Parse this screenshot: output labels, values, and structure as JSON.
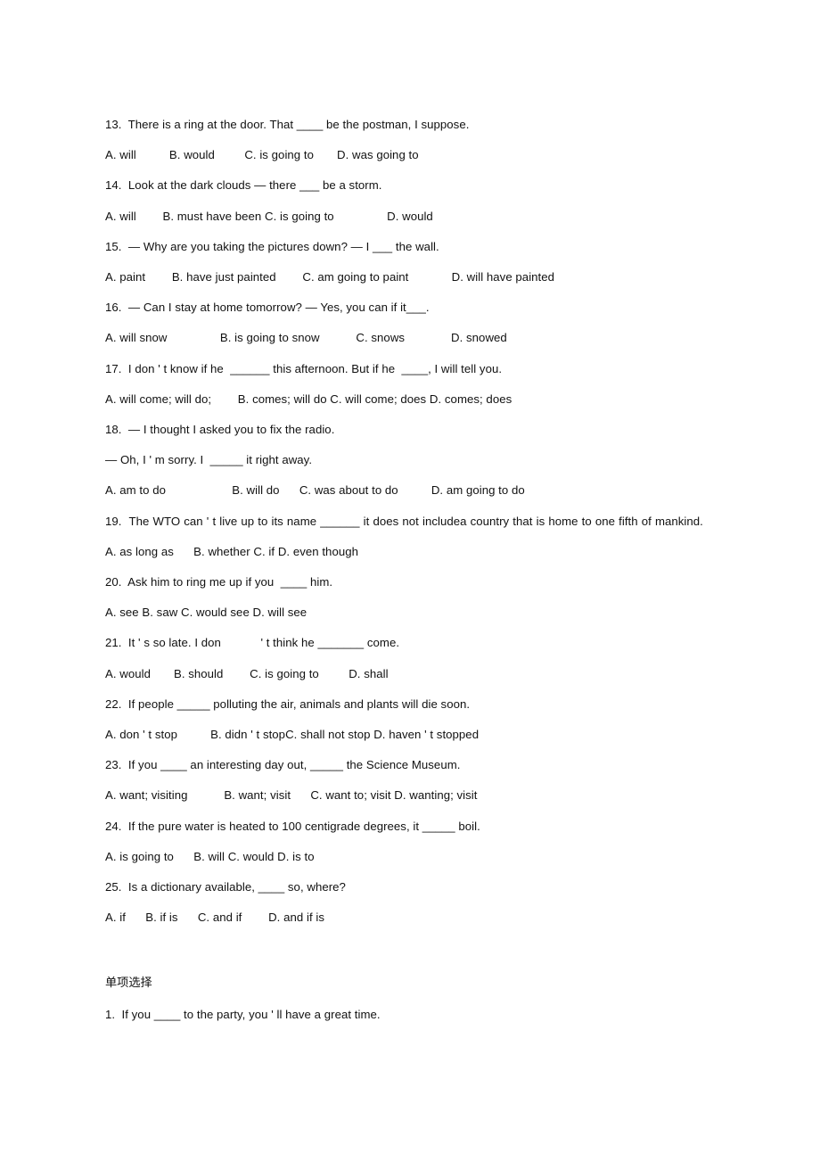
{
  "document": {
    "type": "english-grammar-worksheet",
    "page_background": "#ffffff",
    "text_color": "#111111",
    "blocks": [
      {
        "id": "q13_stem",
        "role": "question-stem",
        "text": "13.  There is a ring at the door. That ____ be the postman, I suppose."
      },
      {
        "id": "q13_opts",
        "role": "answer-options",
        "text": "A. will          B. would         C. is going to       D. was going to"
      },
      {
        "id": "q14_stem",
        "role": "question-stem",
        "text": "14.  Look at the dark clouds — there ___ be a storm."
      },
      {
        "id": "q14_opts",
        "role": "answer-options",
        "text": "A. will        B. must have been C. is going to                D. would"
      },
      {
        "id": "q15_stem",
        "role": "question-stem",
        "text": "15.  — Why are you taking the pictures down? — I ___ the wall."
      },
      {
        "id": "q15_opts",
        "role": "answer-options",
        "text": "A. paint        B. have just painted        C. am going to paint             D. will have painted"
      },
      {
        "id": "q16_stem",
        "role": "question-stem",
        "text": "16.  — Can I stay at home tomorrow? — Yes, you can if it___."
      },
      {
        "id": "q16_opts",
        "role": "answer-options",
        "text": "A. will snow                B. is going to snow           C. snows              D. snowed"
      },
      {
        "id": "q17_stem",
        "role": "question-stem",
        "text": "17.  I don ' t know if he  ______ this afternoon. But if he  ____, I will tell you."
      },
      {
        "id": "q17_opts",
        "role": "answer-options",
        "text": "A. will come; will do;        B. comes; will do C. will come; does D. comes; does"
      },
      {
        "id": "q18_stem",
        "role": "question-stem",
        "text": "18.  — I thought I asked you to fix the radio."
      },
      {
        "id": "q18_stem2",
        "role": "question-stem",
        "text": "— Oh, I ' m sorry. I  _____ it right away."
      },
      {
        "id": "q18_opts",
        "role": "answer-options",
        "text": "A. am to do                    B. will do      C. was about to do          D. am going to do"
      },
      {
        "id": "q19_stem",
        "role": "question-stem",
        "text": "19.  The WTO can ' t live up to its name ______ it does not includea country that is home to one fifth of mankind."
      },
      {
        "id": "q19_opts",
        "role": "answer-options",
        "text": "A. as long as      B. whether C. if D. even though"
      },
      {
        "id": "q20_stem",
        "role": "question-stem",
        "text": "20.  Ask him to ring me up if you  ____ him."
      },
      {
        "id": "q20_opts",
        "role": "answer-options",
        "text": "A. see B. saw C. would see D. will see"
      },
      {
        "id": "q21_stem",
        "role": "question-stem",
        "text": "21.  It ' s so late. I don            ' t think he _______ come."
      },
      {
        "id": "q21_opts",
        "role": "answer-options",
        "text": "A. would       B. should        C. is going to         D. shall"
      },
      {
        "id": "q22_stem",
        "role": "question-stem",
        "text": "22.  If people _____ polluting the air, animals and plants will die soon."
      },
      {
        "id": "q22_opts",
        "role": "answer-options",
        "text": "A. don ' t stop          B. didn ' t stopC. shall not stop D. haven ' t stopped"
      },
      {
        "id": "q23_stem",
        "role": "question-stem",
        "text": "23.  If you ____ an interesting day out, _____ the Science Museum."
      },
      {
        "id": "q23_opts",
        "role": "answer-options",
        "text": "A. want; visiting           B. want; visit      C. want to; visit D. wanting; visit"
      },
      {
        "id": "q24_stem",
        "role": "question-stem",
        "text": "24.  If the pure water is heated to 100 centigrade degrees, it _____ boil."
      },
      {
        "id": "q24_opts",
        "role": "answer-options",
        "text": "A. is going to      B. will C. would D. is to"
      },
      {
        "id": "q25_stem",
        "role": "question-stem",
        "text": "25.  Is a dictionary available, ____ so, where?"
      },
      {
        "id": "q25_opts",
        "role": "answer-options",
        "text": "A. if      B. if is      C. and if        D. and if is"
      }
    ],
    "section_heading": "单项选择",
    "section_blocks": [
      {
        "id": "s2_q1_stem",
        "role": "question-stem",
        "text": "1.  If you ____ to the party, you ' ll have a great time."
      }
    ]
  }
}
